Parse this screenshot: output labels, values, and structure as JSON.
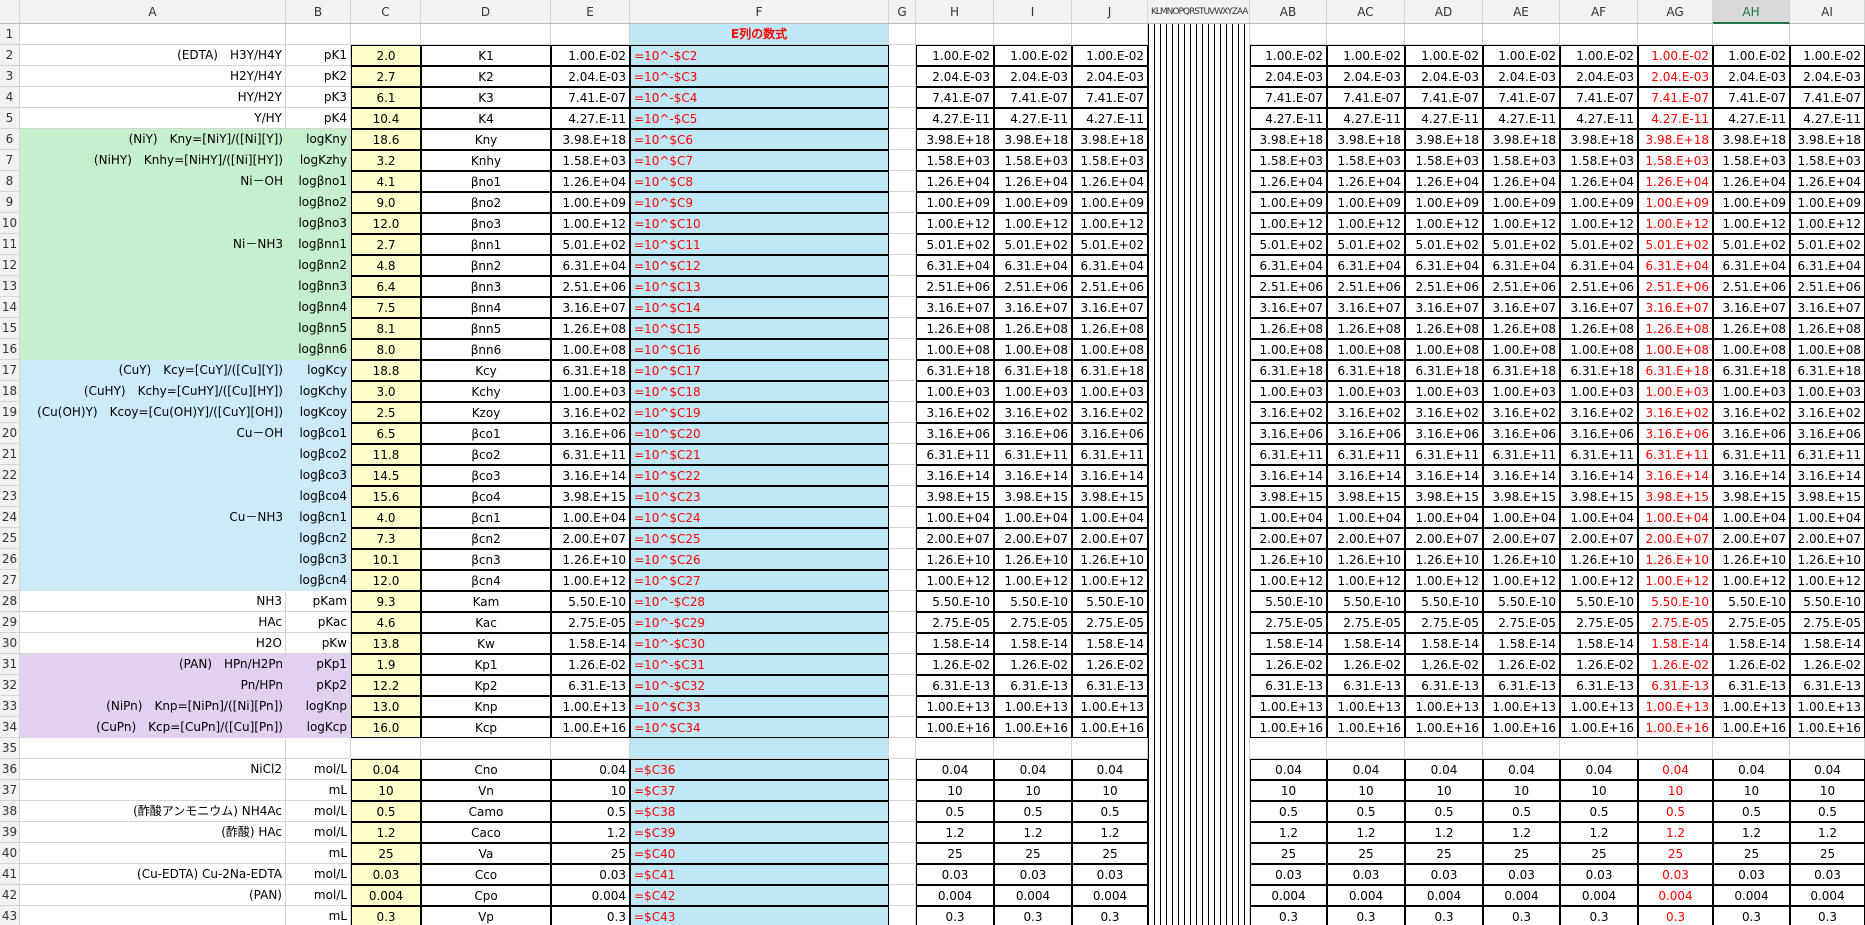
{
  "columns": [
    "A",
    "B",
    "C",
    "D",
    "E",
    "F",
    "G",
    "H",
    "I",
    "J",
    "K",
    "L",
    "M",
    "N",
    "O",
    "P",
    "Q",
    "R",
    "S",
    "T",
    "U",
    "V",
    "W",
    "X",
    "Y",
    "Z",
    "AA",
    "AB",
    "AC",
    "AD",
    "AE",
    "AF",
    "AG",
    "AH",
    "AI"
  ],
  "narrow_label": "KLMNOPQRSTUVWXYZAA",
  "f_header": "E列の数式",
  "active_column": "AH",
  "red_column": "AG",
  "rows": [
    {
      "n": "1"
    },
    {
      "n": "2",
      "a": "(EDTA)　H3Y/H4Y",
      "b": "pK1",
      "c": "2.0",
      "d": "K1",
      "e": "1.00.E-02",
      "f": "=10^-$C2"
    },
    {
      "n": "3",
      "a": "H2Y/H4Y",
      "b": "pK2",
      "c": "2.7",
      "d": "K2",
      "e": "2.04.E-03",
      "f": "=10^-$C3"
    },
    {
      "n": "4",
      "a": "HY/H2Y",
      "b": "pK3",
      "c": "6.1",
      "d": "K3",
      "e": "7.41.E-07",
      "f": "=10^-$C4"
    },
    {
      "n": "5",
      "a": "Y/HY",
      "b": "pK4",
      "c": "10.4",
      "d": "K4",
      "e": "4.27.E-11",
      "f": "=10^-$C5"
    },
    {
      "n": "6",
      "a": "(NiY)　Kny=[NiY]/([Ni][Y])",
      "b": "logKny",
      "c": "18.6",
      "d": "Kny",
      "e": "3.98.E+18",
      "f": "=10^$C6"
    },
    {
      "n": "7",
      "a": "(NiHY)　Knhy=[NiHY]/([Ni][HY])",
      "b": "logKzhy",
      "c": "3.2",
      "d": "Knhy",
      "e": "1.58.E+03",
      "f": "=10^$C7"
    },
    {
      "n": "8",
      "a": "Ni－OH",
      "b": "logβno1",
      "c": "4.1",
      "d": "βno1",
      "e": "1.26.E+04",
      "f": "=10^$C8"
    },
    {
      "n": "9",
      "a": "",
      "b": "logβno2",
      "c": "9.0",
      "d": "βno2",
      "e": "1.00.E+09",
      "f": "=10^$C9"
    },
    {
      "n": "10",
      "a": "",
      "b": "logβno3",
      "c": "12.0",
      "d": "βno3",
      "e": "1.00.E+12",
      "f": "=10^$C10"
    },
    {
      "n": "11",
      "a": "Ni－NH3",
      "b": "logβnn1",
      "c": "2.7",
      "d": "βnn1",
      "e": "5.01.E+02",
      "f": "=10^$C11"
    },
    {
      "n": "12",
      "a": "",
      "b": "logβnn2",
      "c": "4.8",
      "d": "βnn2",
      "e": "6.31.E+04",
      "f": "=10^$C12"
    },
    {
      "n": "13",
      "a": "",
      "b": "logβnn3",
      "c": "6.4",
      "d": "βnn3",
      "e": "2.51.E+06",
      "f": "=10^$C13"
    },
    {
      "n": "14",
      "a": "",
      "b": "logβnn4",
      "c": "7.5",
      "d": "βnn4",
      "e": "3.16.E+07",
      "f": "=10^$C14"
    },
    {
      "n": "15",
      "a": "",
      "b": "logβnn5",
      "c": "8.1",
      "d": "βnn5",
      "e": "1.26.E+08",
      "f": "=10^$C15"
    },
    {
      "n": "16",
      "a": "",
      "b": "logβnn6",
      "c": "8.0",
      "d": "βnn6",
      "e": "1.00.E+08",
      "f": "=10^$C16"
    },
    {
      "n": "17",
      "a": "(CuY)　Kcy=[CuY]/([Cu][Y])",
      "b": "logKcy",
      "c": "18.8",
      "d": "Kcy",
      "e": "6.31.E+18",
      "f": "=10^$C17"
    },
    {
      "n": "18",
      "a": "(CuHY)　Kchy=[CuHY]/([Cu][HY])",
      "b": "logKchy",
      "c": "3.0",
      "d": "Kchy",
      "e": "1.00.E+03",
      "f": "=10^$C18"
    },
    {
      "n": "19",
      "a": "(Cu(OH)Y)　Kcoy=[Cu(OH)Y]/([CuY][OH])",
      "b": "logKcoy",
      "c": "2.5",
      "d": "Kzoy",
      "e": "3.16.E+02",
      "f": "=10^$C19"
    },
    {
      "n": "20",
      "a": "Cu－OH",
      "b": "logβco1",
      "c": "6.5",
      "d": "βco1",
      "e": "3.16.E+06",
      "f": "=10^$C20"
    },
    {
      "n": "21",
      "a": "",
      "b": "logβco2",
      "c": "11.8",
      "d": "βco2",
      "e": "6.31.E+11",
      "f": "=10^$C21"
    },
    {
      "n": "22",
      "a": "",
      "b": "logβco3",
      "c": "14.5",
      "d": "βco3",
      "e": "3.16.E+14",
      "f": "=10^$C22"
    },
    {
      "n": "23",
      "a": "",
      "b": "logβco4",
      "c": "15.6",
      "d": "βco4",
      "e": "3.98.E+15",
      "f": "=10^$C23"
    },
    {
      "n": "24",
      "a": "Cu－NH3",
      "b": "logβcn1",
      "c": "4.0",
      "d": "βcn1",
      "e": "1.00.E+04",
      "f": "=10^$C24"
    },
    {
      "n": "25",
      "a": "",
      "b": "logβcn2",
      "c": "7.3",
      "d": "βcn2",
      "e": "2.00.E+07",
      "f": "=10^$C25"
    },
    {
      "n": "26",
      "a": "",
      "b": "logβcn3",
      "c": "10.1",
      "d": "βcn3",
      "e": "1.26.E+10",
      "f": "=10^$C26"
    },
    {
      "n": "27",
      "a": "",
      "b": "logβcn4",
      "c": "12.0",
      "d": "βcn4",
      "e": "1.00.E+12",
      "f": "=10^$C27"
    },
    {
      "n": "28",
      "a": "NH3",
      "b": "pKam",
      "c": "9.3",
      "d": "Kam",
      "e": "5.50.E-10",
      "f": "=10^-$C28"
    },
    {
      "n": "29",
      "a": "HAc",
      "b": "pKac",
      "c": "4.6",
      "d": "Kac",
      "e": "2.75.E-05",
      "f": "=10^-$C29"
    },
    {
      "n": "30",
      "a": "H2O",
      "b": "pKw",
      "c": "13.8",
      "d": "Kw",
      "e": "1.58.E-14",
      "f": "=10^-$C30"
    },
    {
      "n": "31",
      "a": "(PAN)　HPn/H2Pn",
      "b": "pKp1",
      "c": "1.9",
      "d": "Kp1",
      "e": "1.26.E-02",
      "f": "=10^-$C31"
    },
    {
      "n": "32",
      "a": "Pn/HPn",
      "b": "pKp2",
      "c": "12.2",
      "d": "Kp2",
      "e": "6.31.E-13",
      "f": "=10^-$C32"
    },
    {
      "n": "33",
      "a": "(NiPn)　Knp=[NiPn]/([Ni][Pn])",
      "b": "logKnp",
      "c": "13.0",
      "d": "Knp",
      "e": "1.00.E+13",
      "f": "=10^$C33"
    },
    {
      "n": "34",
      "a": "(CuPn)　Kcp=[CuPn]/([Cu][Pn])",
      "b": "logKcp",
      "c": "16.0",
      "d": "Kcp",
      "e": "1.00.E+16",
      "f": "=10^$C34"
    },
    {
      "n": "35"
    },
    {
      "n": "36",
      "a": "NiCl2",
      "b": "mol/L",
      "c": "0.04",
      "d": "Cno",
      "e": "0.04",
      "f": "=$C36"
    },
    {
      "n": "37",
      "a": "",
      "b": "mL",
      "c": "10",
      "d": "Vn",
      "e": "10",
      "f": "=$C37"
    },
    {
      "n": "38",
      "a": "(酢酸アンモニウム) NH4Ac",
      "b": "mol/L",
      "c": "0.5",
      "d": "Camo",
      "e": "0.5",
      "f": "=$C38"
    },
    {
      "n": "39",
      "a": "(酢酸) HAc",
      "b": "mol/L",
      "c": "1.2",
      "d": "Caco",
      "e": "1.2",
      "f": "=$C39"
    },
    {
      "n": "40",
      "a": "",
      "b": "mL",
      "c": "25",
      "d": "Va",
      "e": "25",
      "f": "=$C40"
    },
    {
      "n": "41",
      "a": "(Cu-EDTA) Cu-2Na-EDTA",
      "b": "mol/L",
      "c": "0.03",
      "d": "Cco",
      "e": "0.03",
      "f": "=$C41"
    },
    {
      "n": "42",
      "a": "(PAN)",
      "b": "mol/L",
      "c": "0.004",
      "d": "Cpo",
      "e": "0.004",
      "f": "=$C42"
    },
    {
      "n": "43",
      "a": "",
      "b": "mL",
      "c": "0.3",
      "d": "Vp",
      "e": "0.3",
      "f": "=$C43"
    }
  ]
}
